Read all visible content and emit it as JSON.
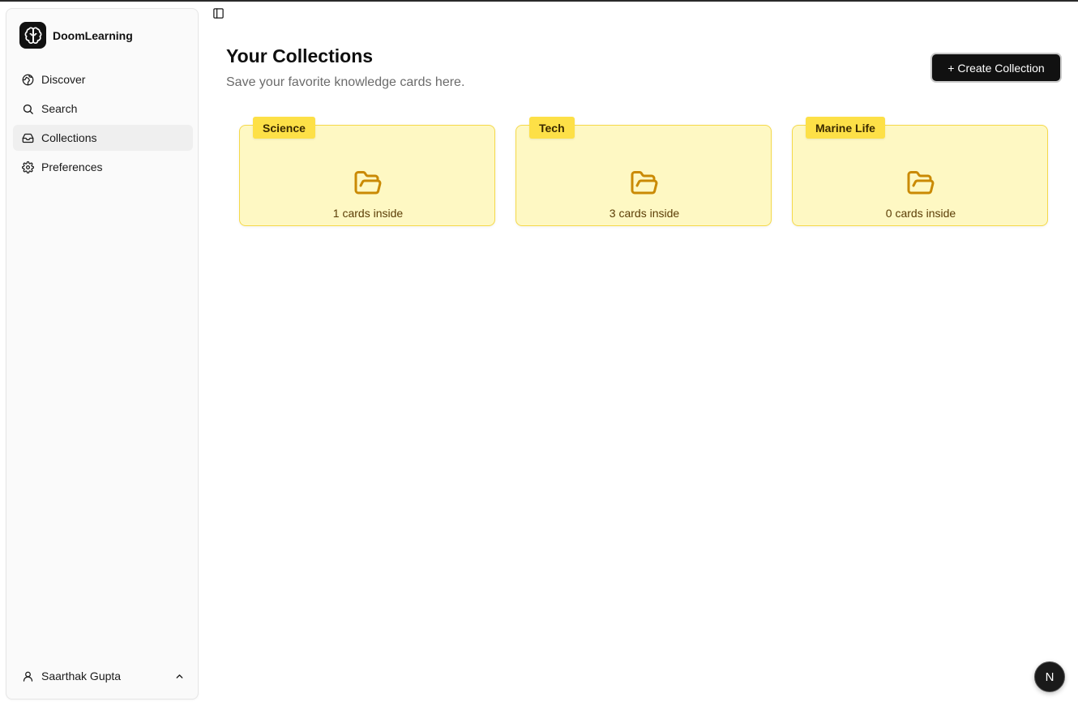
{
  "brand": {
    "name": "DoomLearning",
    "icon": "brain-icon"
  },
  "sidebar": {
    "items": [
      {
        "label": "Discover",
        "icon": "globe-icon",
        "active": false
      },
      {
        "label": "Search",
        "icon": "search-icon",
        "active": false
      },
      {
        "label": "Collections",
        "icon": "inbox-icon",
        "active": true
      },
      {
        "label": "Preferences",
        "icon": "gear-icon",
        "active": false
      }
    ],
    "user": {
      "name": "Saarthak Gupta",
      "icon": "user-icon",
      "menu_icon": "chevron-up-icon"
    },
    "toggle_icon": "panel-left-icon"
  },
  "main": {
    "title": "Your Collections",
    "subtitle": "Save your favorite knowledge cards here.",
    "create_button_label": "+ Create Collection",
    "collections": [
      {
        "name": "Science",
        "count_label": "1 cards inside",
        "icon": "folder-open-icon"
      },
      {
        "name": "Tech",
        "count_label": "3 cards inside",
        "icon": "folder-open-icon"
      },
      {
        "name": "Marine Life",
        "count_label": "0 cards inside",
        "icon": "folder-open-icon"
      }
    ]
  },
  "badge": {
    "label": "N"
  },
  "colors": {
    "card_bg": "#fef8c3",
    "card_border": "#f5d94a",
    "tab_bg": "#fde047",
    "folder_icon": "#ca8a04",
    "button_bg": "#111111"
  }
}
